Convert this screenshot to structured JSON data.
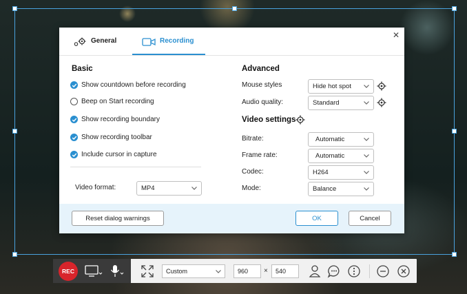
{
  "tabs": [
    {
      "label": "General",
      "icon": "gears-icon"
    },
    {
      "label": "Recording",
      "icon": "camera-icon"
    }
  ],
  "basic": {
    "title": "Basic",
    "options": [
      {
        "label": "Show countdown before recording",
        "checked": true
      },
      {
        "label": "Beep on Start recording",
        "checked": false
      },
      {
        "label": "Show recording boundary",
        "checked": true
      },
      {
        "label": "Show recording toolbar",
        "checked": true
      },
      {
        "label": "Include cursor in capture",
        "checked": true
      }
    ],
    "video_format_label": "Video format:",
    "video_format_value": "MP4"
  },
  "advanced": {
    "title": "Advanced",
    "mouse_styles_label": "Mouse styles",
    "mouse_styles_value": "Hide hot spot",
    "audio_quality_label": "Audio quality:",
    "audio_quality_value": "Standard"
  },
  "video_settings": {
    "title": "Video settings",
    "bitrate_label": "Bitrate:",
    "bitrate_value": "Automatic",
    "frame_rate_label": "Frame rate:",
    "frame_rate_value": "Automatic",
    "codec_label": "Codec:",
    "codec_value": "H264",
    "mode_label": "Mode:",
    "mode_value": "Balance"
  },
  "footer": {
    "reset_label": "Reset dialog warnings",
    "ok_label": "OK",
    "cancel_label": "Cancel"
  },
  "toolbar": {
    "rec_label": "REC",
    "region_value": "Custom",
    "width_value": "960",
    "times_symbol": "×",
    "height_value": "540"
  },
  "colors": {
    "accent": "#2a8fd0",
    "rec": "#d8242b",
    "footer_bg": "#e6f3fb",
    "selection_border": "#4aa3df"
  }
}
